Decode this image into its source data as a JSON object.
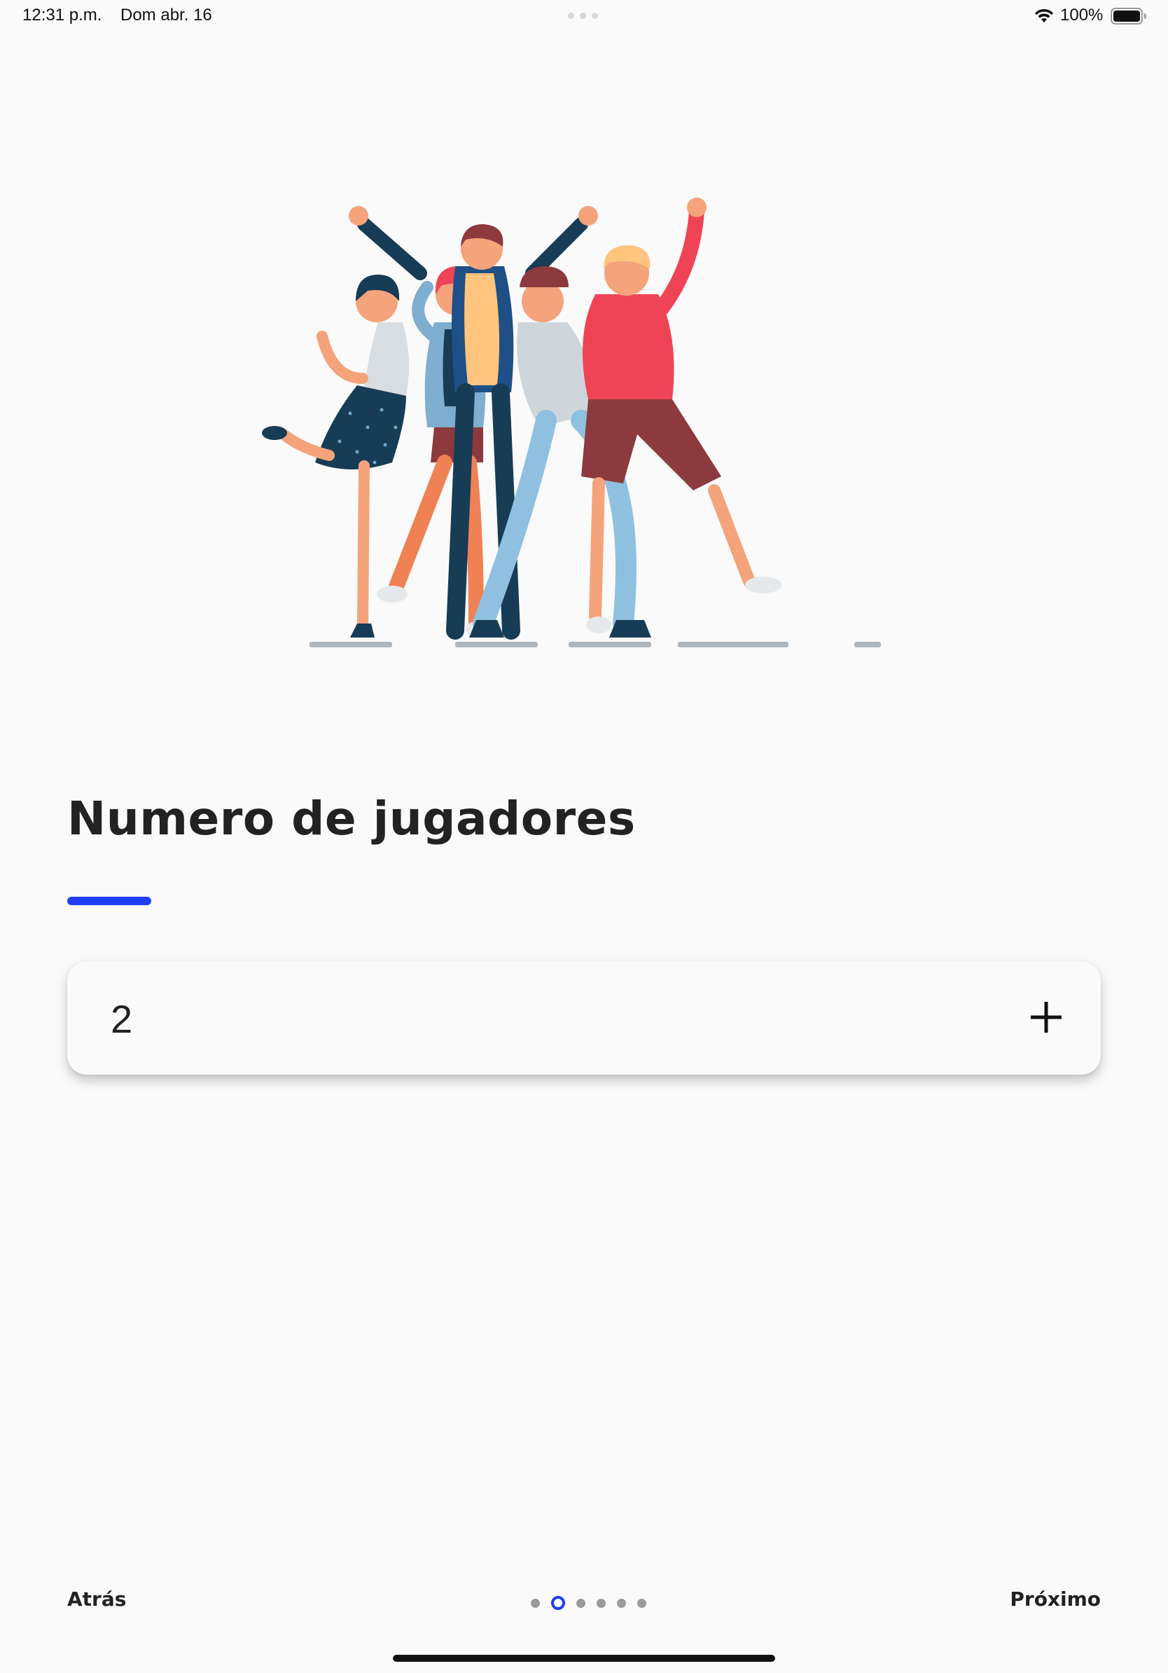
{
  "status_bar": {
    "time": "12:31 p.m.",
    "date": "Dom abr. 16",
    "battery": "100%"
  },
  "hero": {
    "illustration": "group-of-friends-celebrating"
  },
  "main": {
    "title": "Numero de jugadores",
    "accent_color": "#1f3ef5",
    "player_count": "2",
    "increment_icon": "plus-icon"
  },
  "footer": {
    "back_label": "Atrás",
    "next_label": "Próximo",
    "page_count": 6,
    "current_page": 2
  }
}
